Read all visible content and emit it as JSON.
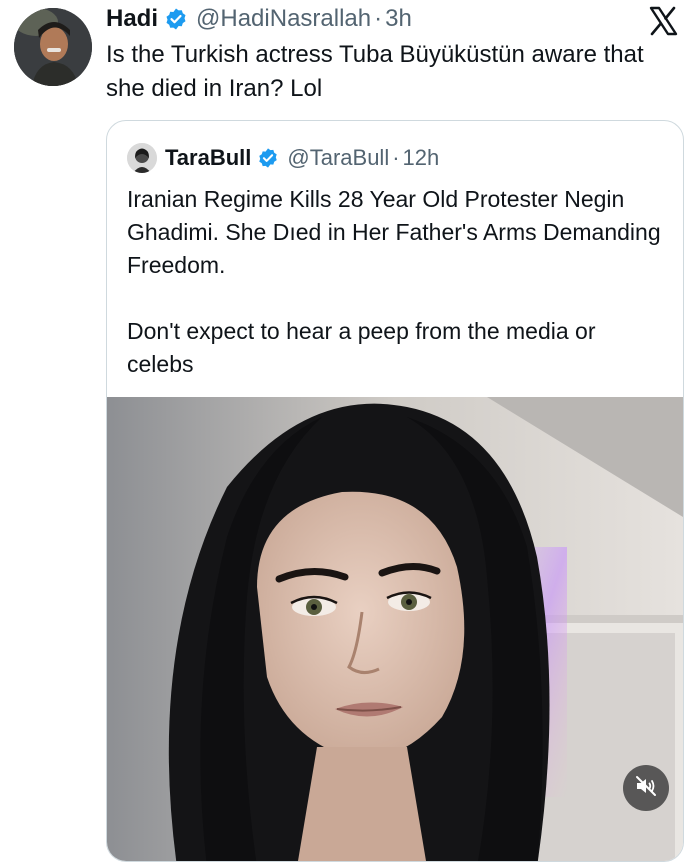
{
  "tweet": {
    "author_name": "Hadi",
    "author_handle": "@HadiNasrallah",
    "separator": "·",
    "time": "3h",
    "text": "Is the Turkish actress Tuba Büyüküstün aware that she died in Iran? Lol"
  },
  "quoted": {
    "author_name": "TaraBull",
    "author_handle": "@TaraBull",
    "separator": "·",
    "time": "12h",
    "paragraphs": [
      "Iranian Regime Kills 28 Year Old Protester Negin Ghadimi. She Dıed in Her Father's Arms Demanding Freedom.",
      "Don't expect to hear a peep from the media or celebs"
    ]
  },
  "icons": {
    "verified": "verified-badge-icon",
    "platform": "x-logo-icon",
    "muted": "speaker-muted-icon"
  },
  "colors": {
    "verified_blue": "#1d9bf0",
    "text_primary": "#0f1419",
    "text_secondary": "#536471",
    "border": "#cfd9de"
  }
}
